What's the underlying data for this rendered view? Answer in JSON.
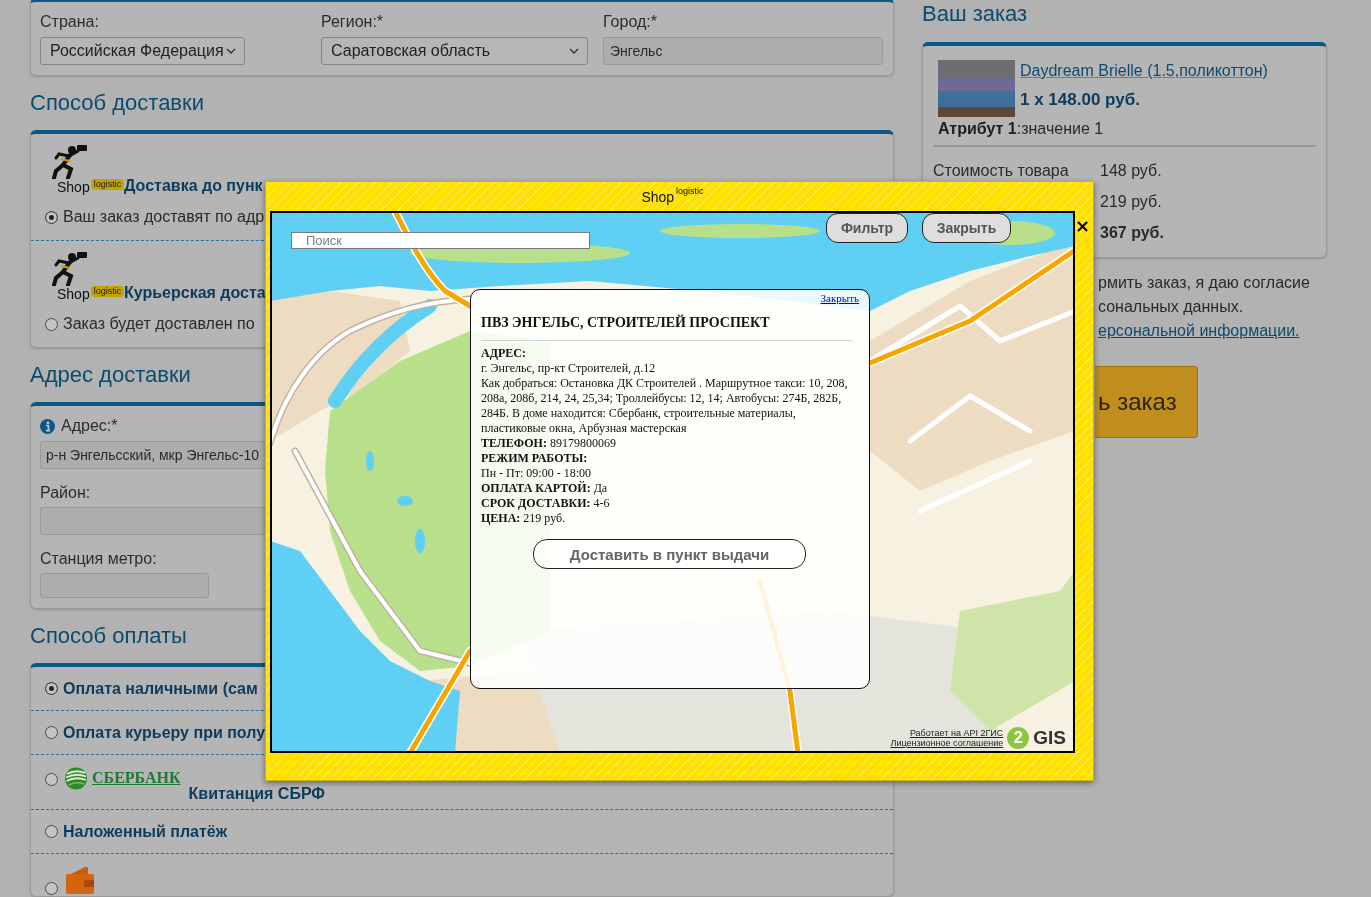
{
  "location": {
    "fields": [
      {
        "kind": "select",
        "label": "Страна:",
        "value": "Российская Федерация"
      },
      {
        "kind": "select",
        "label": "Регион:*",
        "value": "Саратовская область"
      },
      {
        "kind": "input",
        "label": "Город:*",
        "value": "Энгельс"
      }
    ]
  },
  "delivery": {
    "title": "Способ доставки",
    "options": [
      {
        "logo": {
          "name": "Shop",
          "tag": "logistic"
        },
        "title": "Доставка до пунк",
        "description": "Ваш заказ доставят по адр",
        "selected": true
      },
      {
        "logo": {
          "name": "Shop",
          "tag": "logistic"
        },
        "title": "Курьерская доста",
        "description": "Заказ будет доставлен по",
        "selected": false
      }
    ]
  },
  "address": {
    "title": "Адрес доставки",
    "fields": [
      {
        "kind": "wide",
        "label": "Адрес:*",
        "info": true,
        "value": "р-н Энгельсский, мкр Энгельс-10"
      },
      {
        "kind": "wide",
        "label": "Район:",
        "info": false
      },
      {
        "kind": "short",
        "label": "Станция метро:",
        "info": false
      }
    ]
  },
  "payment": {
    "title": "Способ оплаты",
    "options": [
      {
        "kind": "text",
        "label": "Оплата наличными (сам",
        "selected": true
      },
      {
        "kind": "text",
        "label": "Оплата курьеру при полу",
        "selected": false
      },
      {
        "kind": "bank",
        "brand": "СБЕРБАНК",
        "label": "Квитанция СБРФ",
        "selected": false
      },
      {
        "kind": "text",
        "label": "Наложенный платёж",
        "selected": false
      },
      {
        "kind": "wallet",
        "selected": false
      }
    ]
  },
  "order": {
    "title": "Ваш заказ",
    "product": {
      "name": "Daydream Brielle (1.5,поликоттон)",
      "price": "1 x 148.00 руб.",
      "attribute": "**Атрибут 1**:значение 1"
    },
    "totals": [
      {
        "label": "Стоимость товара",
        "value": "148 руб.",
        "total": false
      },
      {
        "value": "219 руб.",
        "total": false
      },
      {
        "value": "367 руб.",
        "total": true
      }
    ]
  },
  "consent": {
    "lines": [
      "рмить заказ, я даю согласие",
      "сональных данных."
    ],
    "link": "ерсональной информации."
  },
  "checkout": {
    "label": "ь заказ"
  },
  "modal": {
    "title": {
      "name": "Shop",
      "tag": "logistic"
    },
    "close": "×",
    "search": {
      "placeholder": "Поиск"
    },
    "buttons": [
      "Фильтр",
      "Закрыть"
    ],
    "point": {
      "close": "Закрыть",
      "title": "ПВЗ ЭНГЕЛЬС, СТРОИТЕЛЕЙ ПРОСПЕКТ",
      "details": [
        {
          "kind": "heading",
          "text": "АДРЕС:"
        },
        {
          "kind": "text",
          "text": "г. Энгельс, пр-кт Строителей, д.12"
        },
        {
          "kind": "text",
          "text": "Как добраться: Остановка ДК Строителей . Маршрутное такси: 10, 208, 208а, 208б, 214, 24, 25,34; Троллейбусы: 12, 14; Автобусы: 274Б, 282Б, 284Б. В доме находится: Сбербанк, строительные материалы, пластиковые окна, Арбузная мастерская"
        },
        {
          "kind": "text",
          "text": "**ТЕЛЕФОН:** 89179800069"
        },
        {
          "kind": "heading",
          "text": "РЕЖИМ РАБОТЫ:"
        },
        {
          "kind": "text",
          "text": "Пн - Пт: 09:00 - 18:00"
        },
        {
          "kind": "text",
          "text": "**ОПЛАТА КАРТОЙ:** Да"
        },
        {
          "kind": "text",
          "text": "**СРОК ДОСТАВКИ:** 4-6"
        },
        {
          "kind": "text",
          "text": "**ЦЕНА:** 219 руб."
        }
      ],
      "action": "Доставить в пункт выдачи"
    },
    "attribution": {
      "links": [
        "Работает на API 2ГИС",
        "Лицензионное соглашение"
      ],
      "logo": {
        "mark": "2",
        "text": "GIS"
      }
    }
  }
}
